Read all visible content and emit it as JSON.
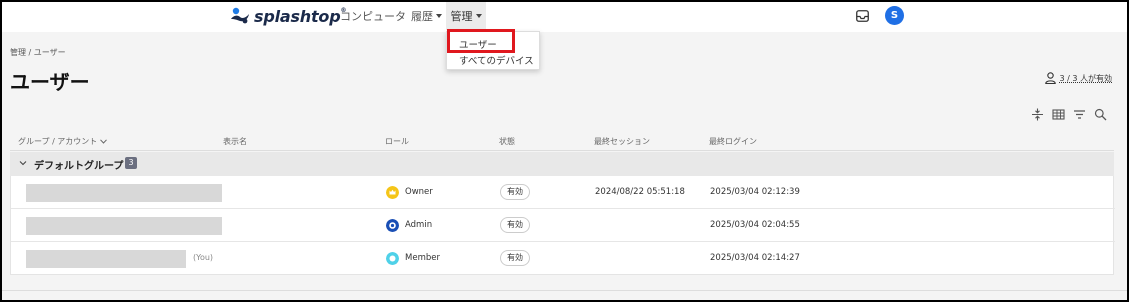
{
  "header": {
    "logo_text": "splashtop",
    "logo_mark": "®",
    "nav": {
      "computers": "コンピュータ",
      "history": "履歴",
      "admin": "管理"
    },
    "avatar_initial": "S"
  },
  "admin_menu": {
    "users": "ユーザー",
    "all_devices": "すべてのデバイス"
  },
  "breadcrumb": "管理 / ユーザー",
  "page": {
    "title": "ユーザー",
    "active_count": "3 / 3 人が有効"
  },
  "table": {
    "headers": {
      "group_account": "グループ / アカウント",
      "display_name": "表示名",
      "role": "ロール",
      "status": "状態",
      "last_session": "最終セッション",
      "last_login": "最終ログイン"
    },
    "group": {
      "name": "デフォルトグループ",
      "count": "3"
    },
    "rows": [
      {
        "role": "Owner",
        "role_color": "#f5c518",
        "status": "有効",
        "last_session": "2024/08/22 05:51:18",
        "last_login": "2025/03/04 02:12:39",
        "you": ""
      },
      {
        "role": "Admin",
        "role_color": "#1a4fb5",
        "status": "有効",
        "last_session": "",
        "last_login": "2025/03/04 02:04:55",
        "you": ""
      },
      {
        "role": "Member",
        "role_color": "#4fd1e8",
        "status": "有効",
        "last_session": "",
        "last_login": "2025/03/04 02:14:27",
        "you": "(You)"
      }
    ]
  },
  "icons": {
    "inbox": "inbox-icon",
    "person": "person-icon",
    "toolbar": [
      "compress-rows-icon",
      "table-columns-icon",
      "filter-icon",
      "search-icon"
    ]
  }
}
